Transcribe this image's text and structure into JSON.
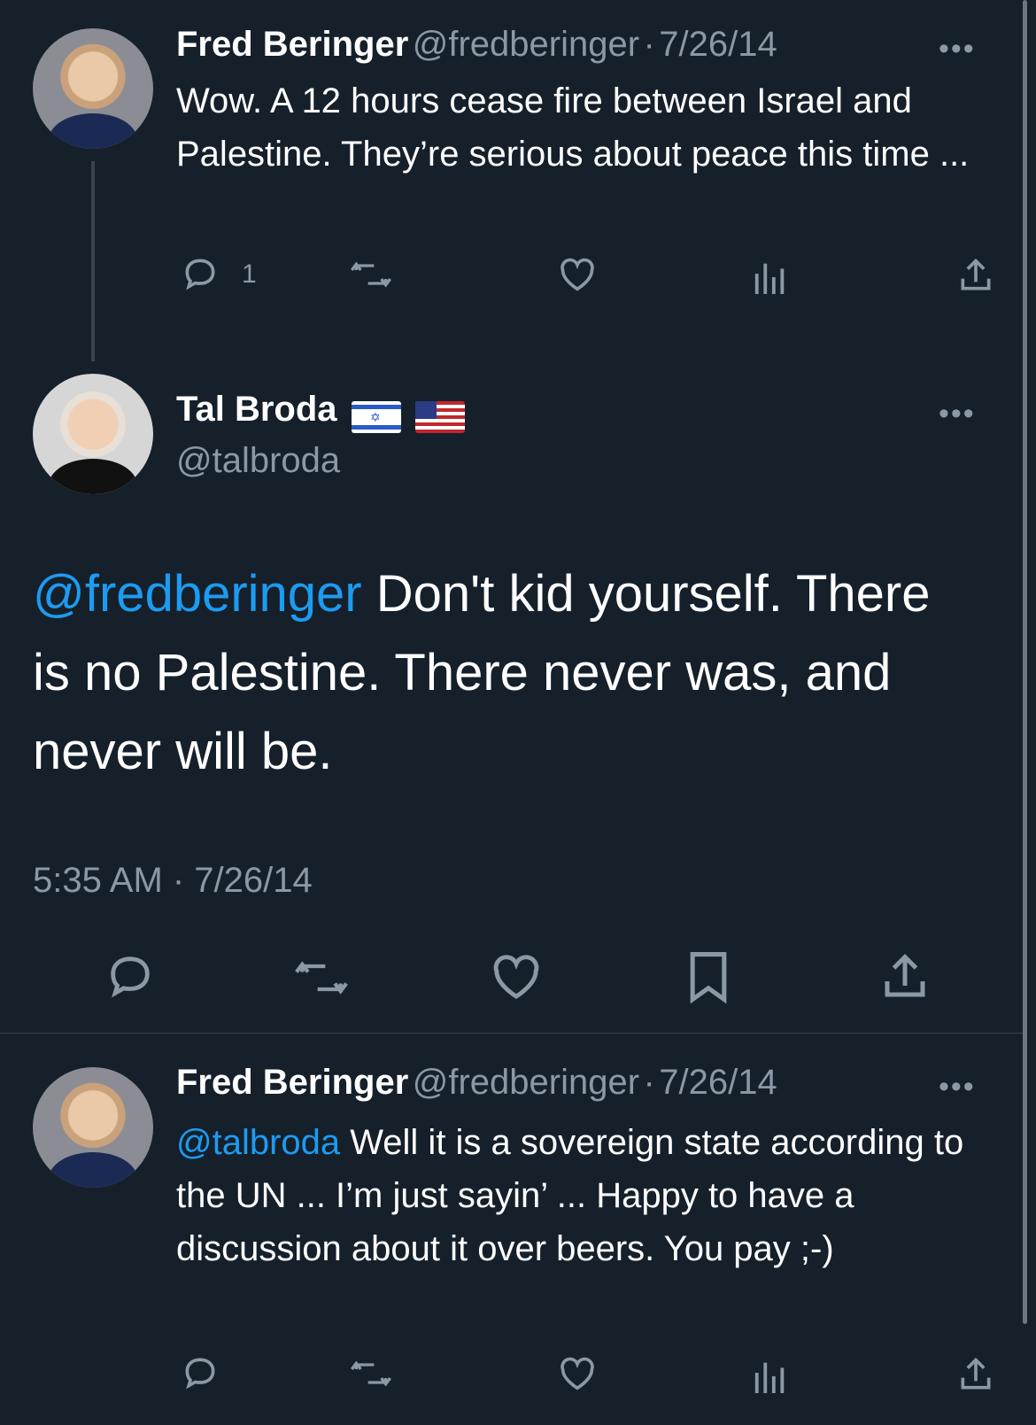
{
  "tweet1": {
    "name": "Fred Beringer",
    "handle": "@fredberinger",
    "separator": "·",
    "date": "7/26/14",
    "more": "•••",
    "text": "Wow. A 12 hours cease fire between Israel and Palestine. They’re serious about peace this time ...",
    "reply_count": "1"
  },
  "main_tweet": {
    "name": "Tal Broda",
    "flags": [
      "israel-flag",
      "us-flag"
    ],
    "handle": "@talbroda",
    "more": "•••",
    "mention": "@fredberinger",
    "text": " Don't kid yourself. There is no Palestine. There never was, and never will be.",
    "timestamp": "5:35 AM · 7/26/14"
  },
  "tweet2": {
    "name": "Fred Beringer",
    "handle": "@fredberinger",
    "separator": "·",
    "date": "7/26/14",
    "more": "•••",
    "mention": "@talbroda",
    "text": " Well it is a sovereign state according to the UN ... I’m just sayin’ ... Happy to have a discussion about it over beers. You pay ;-)"
  },
  "icons": {
    "reply": "reply-icon",
    "retweet": "retweet-icon",
    "like": "like-icon",
    "views": "views-icon",
    "bookmark": "bookmark-icon",
    "share": "share-icon"
  },
  "colors": {
    "background": "#15202b",
    "accent": "#1d9bf0",
    "secondary_text": "#8b98a5"
  }
}
